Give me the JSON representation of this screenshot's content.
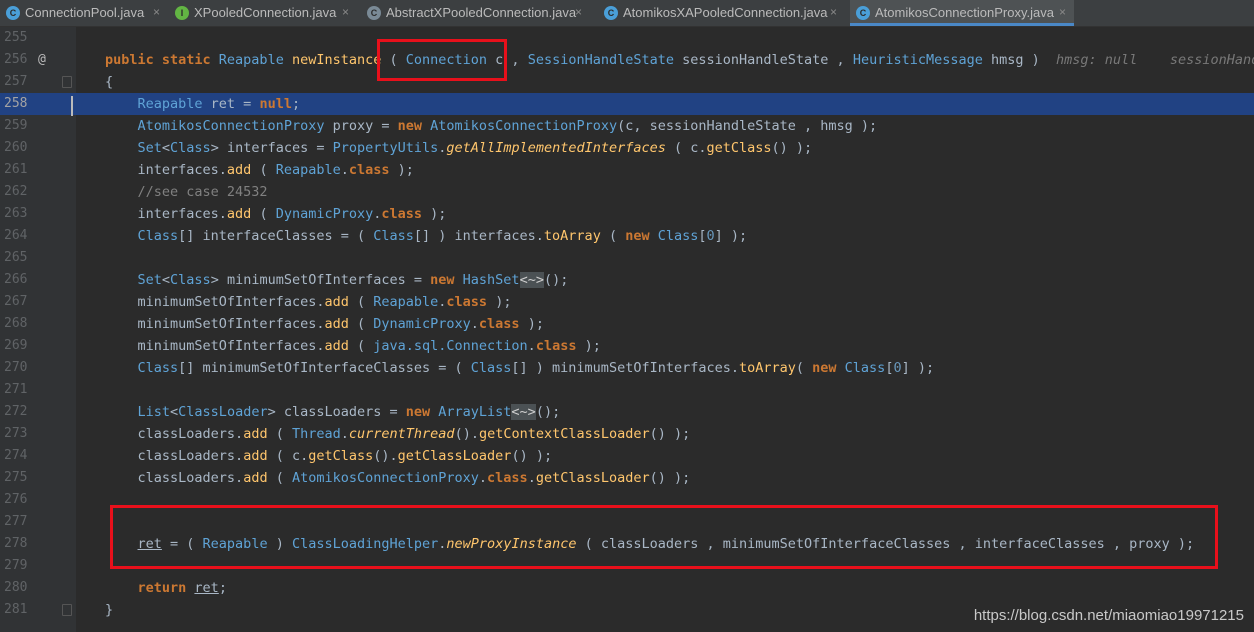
{
  "tabs": [
    {
      "label": "ConnectionPool.java",
      "icon": "C",
      "icon_name": "class-icon"
    },
    {
      "label": "XPooledConnection.java",
      "icon": "I",
      "icon_name": "interface-icon"
    },
    {
      "label": "AbstractXPooledConnection.java",
      "icon": "C",
      "icon_name": "abstract-class-icon"
    },
    {
      "label": "AtomikosXAPooledConnection.java",
      "icon": "C",
      "icon_name": "class-icon"
    },
    {
      "label": "AtomikosConnectionProxy.java",
      "icon": "C",
      "icon_name": "class-icon",
      "active": true
    }
  ],
  "close_symbol": "×",
  "colors": {
    "keyword": "#cc7832",
    "type": "#5fa3d6",
    "method": "#ffc66d",
    "highlight": "#e8101b",
    "current_line": "#214283"
  },
  "gutter": {
    "line_numbers": [
      "255",
      "256",
      "257",
      "258",
      "259",
      "260",
      "261",
      "262",
      "263",
      "264",
      "265",
      "266",
      "267",
      "268",
      "269",
      "270",
      "271",
      "272",
      "273",
      "274",
      "275",
      "276",
      "277",
      "278",
      "279",
      "280",
      "281"
    ]
  },
  "editor": {
    "current_line": "258",
    "hints": {
      "hmsg": "hmsg: null",
      "sessionHandle": "sessionHandle"
    }
  },
  "watermark": "https://blog.csdn.net/miaomiao19971215"
}
